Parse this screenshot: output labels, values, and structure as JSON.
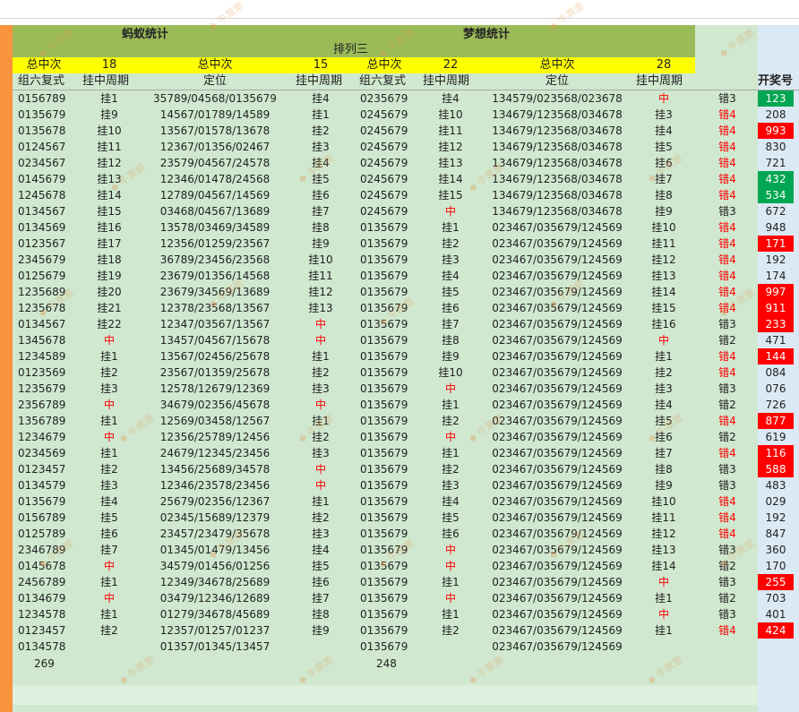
{
  "titles": {
    "left": "蚂蚁统计",
    "right": "梦想统计",
    "sub": "排列三"
  },
  "summary": {
    "label": "总中次",
    "a_hits": "18",
    "b_hits": "15",
    "c_hits": "22",
    "d_hits": "28"
  },
  "columns": {
    "combo": "组六复式",
    "cycle": "挂中周期",
    "pos": "定位",
    "result": "开奖号"
  },
  "rows": [
    {
      "a": "0156789",
      "b": "挂1",
      "c": "35789/04568/0135679",
      "d": "挂4",
      "e": "0235679",
      "f": "挂4",
      "g": "134579/023568/023678",
      "h": "中",
      "i": "错3",
      "r": "123",
      "rc": "g"
    },
    {
      "a": "0135679",
      "b": "挂9",
      "c": "14567/01789/14589",
      "d": "挂1",
      "e": "0245679",
      "f": "挂10",
      "g": "134679/123568/034678",
      "h": "挂3",
      "i": "错4",
      "r": "208",
      "rc": ""
    },
    {
      "a": "0135678",
      "b": "挂10",
      "c": "13567/01578/13678",
      "d": "挂2",
      "e": "0245679",
      "f": "挂11",
      "g": "134679/123568/034678",
      "h": "挂4",
      "i": "错4",
      "r": "993",
      "rc": "r"
    },
    {
      "a": "0124567",
      "b": "挂11",
      "c": "12367/01356/02467",
      "d": "挂3",
      "e": "0245679",
      "f": "挂12",
      "g": "134679/123568/034678",
      "h": "挂5",
      "i": "错4",
      "r": "830",
      "rc": ""
    },
    {
      "a": "0234567",
      "b": "挂12",
      "c": "23579/04567/24578",
      "d": "挂4",
      "e": "0245679",
      "f": "挂13",
      "g": "134679/123568/034678",
      "h": "挂6",
      "i": "错4",
      "r": "721",
      "rc": ""
    },
    {
      "a": "0145679",
      "b": "挂13",
      "c": "12346/01478/24568",
      "d": "挂5",
      "e": "0245679",
      "f": "挂14",
      "g": "134679/123568/034678",
      "h": "挂7",
      "i": "错4",
      "r": "432",
      "rc": "g"
    },
    {
      "a": "1245678",
      "b": "挂14",
      "c": "12789/04567/14569",
      "d": "挂6",
      "e": "0245679",
      "f": "挂15",
      "g": "134679/123568/034678",
      "h": "挂8",
      "i": "错4",
      "r": "534",
      "rc": "g"
    },
    {
      "a": "0134567",
      "b": "挂15",
      "c": "03468/04567/13689",
      "d": "挂7",
      "e": "0245679",
      "f": "中",
      "g": "134679/123568/034678",
      "h": "挂9",
      "i": "错3",
      "r": "672",
      "rc": ""
    },
    {
      "a": "0134569",
      "b": "挂16",
      "c": "13578/03469/34589",
      "d": "挂8",
      "e": "0135679",
      "f": "挂1",
      "g": "023467/035679/124569",
      "h": "挂10",
      "i": "错4",
      "r": "948",
      "rc": ""
    },
    {
      "a": "0123567",
      "b": "挂17",
      "c": "12356/01259/23567",
      "d": "挂9",
      "e": "0135679",
      "f": "挂2",
      "g": "023467/035679/124569",
      "h": "挂11",
      "i": "错4",
      "r": "171",
      "rc": "r"
    },
    {
      "a": "2345679",
      "b": "挂18",
      "c": "36789/23456/23568",
      "d": "挂10",
      "e": "0135679",
      "f": "挂3",
      "g": "023467/035679/124569",
      "h": "挂12",
      "i": "错4",
      "r": "192",
      "rc": ""
    },
    {
      "a": "0125679",
      "b": "挂19",
      "c": "23679/01356/14568",
      "d": "挂11",
      "e": "0135679",
      "f": "挂4",
      "g": "023467/035679/124569",
      "h": "挂13",
      "i": "错4",
      "r": "174",
      "rc": ""
    },
    {
      "a": "1235689",
      "b": "挂20",
      "c": "23679/34569/13689",
      "d": "挂12",
      "e": "0135679",
      "f": "挂5",
      "g": "023467/035679/124569",
      "h": "挂14",
      "i": "错4",
      "r": "997",
      "rc": "r"
    },
    {
      "a": "1235678",
      "b": "挂21",
      "c": "12378/23568/13567",
      "d": "挂13",
      "e": "0135679",
      "f": "挂6",
      "g": "023467/035679/124569",
      "h": "挂15",
      "i": "错4",
      "r": "911",
      "rc": "r"
    },
    {
      "a": "0134567",
      "b": "挂22",
      "c": "12347/03567/13567",
      "d": "中",
      "e": "0135679",
      "f": "挂7",
      "g": "023467/035679/124569",
      "h": "挂16",
      "i": "错3",
      "r": "233",
      "rc": "r"
    },
    {
      "a": "1345678",
      "b": "中",
      "c": "13457/04567/15678",
      "d": "中",
      "e": "0135679",
      "f": "挂8",
      "g": "023467/035679/124569",
      "h": "中",
      "i": "错2",
      "r": "471",
      "rc": ""
    },
    {
      "a": "1234589",
      "b": "挂1",
      "c": "13567/02456/25678",
      "d": "挂1",
      "e": "0135679",
      "f": "挂9",
      "g": "023467/035679/124569",
      "h": "挂1",
      "i": "错4",
      "r": "144",
      "rc": "r"
    },
    {
      "a": "0123569",
      "b": "挂2",
      "c": "23567/01359/25678",
      "d": "挂2",
      "e": "0135679",
      "f": "挂10",
      "g": "023467/035679/124569",
      "h": "挂2",
      "i": "错4",
      "r": "084",
      "rc": ""
    },
    {
      "a": "1235679",
      "b": "挂3",
      "c": "12578/12679/12369",
      "d": "挂3",
      "e": "0135679",
      "f": "中",
      "g": "023467/035679/124569",
      "h": "挂3",
      "i": "错3",
      "r": "076",
      "rc": ""
    },
    {
      "a": "2356789",
      "b": "中",
      "c": "34679/02356/45678",
      "d": "中",
      "e": "0135679",
      "f": "挂1",
      "g": "023467/035679/124569",
      "h": "挂4",
      "i": "错2",
      "r": "726",
      "rc": ""
    },
    {
      "a": "1356789",
      "b": "挂1",
      "c": "12569/03458/12567",
      "d": "挂1",
      "e": "0135679",
      "f": "挂2",
      "g": "023467/035679/124569",
      "h": "挂5",
      "i": "错4",
      "r": "877",
      "rc": "r"
    },
    {
      "a": "1234679",
      "b": "中",
      "c": "12356/25789/12456",
      "d": "挂2",
      "e": "0135679",
      "f": "中",
      "g": "023467/035679/124569",
      "h": "挂6",
      "i": "错2",
      "r": "619",
      "rc": ""
    },
    {
      "a": "0234569",
      "b": "挂1",
      "c": "24679/12345/23456",
      "d": "挂3",
      "e": "0135679",
      "f": "挂1",
      "g": "023467/035679/124569",
      "h": "挂7",
      "i": "错4",
      "r": "116",
      "rc": "r"
    },
    {
      "a": "0123457",
      "b": "挂2",
      "c": "13456/25689/34578",
      "d": "中",
      "e": "0135679",
      "f": "挂2",
      "g": "023467/035679/124569",
      "h": "挂8",
      "i": "错3",
      "r": "588",
      "rc": "r"
    },
    {
      "a": "0134579",
      "b": "挂3",
      "c": "12346/23578/23456",
      "d": "中",
      "e": "0135679",
      "f": "挂3",
      "g": "023467/035679/124569",
      "h": "挂9",
      "i": "错3",
      "r": "483",
      "rc": ""
    },
    {
      "a": "0135679",
      "b": "挂4",
      "c": "25679/02356/12367",
      "d": "挂1",
      "e": "0135679",
      "f": "挂4",
      "g": "023467/035679/124569",
      "h": "挂10",
      "i": "错4",
      "r": "029",
      "rc": ""
    },
    {
      "a": "0156789",
      "b": "挂5",
      "c": "02345/15689/12379",
      "d": "挂2",
      "e": "0135679",
      "f": "挂5",
      "g": "023467/035679/124569",
      "h": "挂11",
      "i": "错4",
      "r": "192",
      "rc": ""
    },
    {
      "a": "0125789",
      "b": "挂6",
      "c": "23457/23479/35678",
      "d": "挂3",
      "e": "0135679",
      "f": "挂6",
      "g": "023467/035679/124569",
      "h": "挂12",
      "i": "错4",
      "r": "847",
      "rc": ""
    },
    {
      "a": "2346789",
      "b": "挂7",
      "c": "01345/01479/13456",
      "d": "挂4",
      "e": "0135679",
      "f": "中",
      "g": "023467/035679/124569",
      "h": "挂13",
      "i": "错3",
      "r": "360",
      "rc": ""
    },
    {
      "a": "0145678",
      "b": "中",
      "c": "34579/01456/01256",
      "d": "挂5",
      "e": "0135679",
      "f": "中",
      "g": "023467/035679/124569",
      "h": "挂14",
      "i": "错2",
      "r": "170",
      "rc": ""
    },
    {
      "a": "2456789",
      "b": "挂1",
      "c": "12349/34678/25689",
      "d": "挂6",
      "e": "0135679",
      "f": "挂1",
      "g": "023467/035679/124569",
      "h": "中",
      "i": "错3",
      "r": "255",
      "rc": "r"
    },
    {
      "a": "0134679",
      "b": "中",
      "c": "03479/12346/12689",
      "d": "挂7",
      "e": "0135679",
      "f": "中",
      "g": "023467/035679/124569",
      "h": "挂1",
      "i": "错2",
      "r": "703",
      "rc": ""
    },
    {
      "a": "1234578",
      "b": "挂1",
      "c": "01279/34678/45689",
      "d": "挂8",
      "e": "0135679",
      "f": "挂1",
      "g": "023467/035679/124569",
      "h": "中",
      "i": "错3",
      "r": "401",
      "rc": ""
    },
    {
      "a": "0123457",
      "b": "挂2",
      "c": "12357/01257/01237",
      "d": "挂9",
      "e": "0135679",
      "f": "挂2",
      "g": "023467/035679/124569",
      "h": "挂1",
      "i": "错4",
      "r": "424",
      "rc": "r"
    },
    {
      "a": "0134578",
      "b": "",
      "c": "01357/01345/13457",
      "d": "",
      "e": "0135679",
      "f": "",
      "g": "023467/035679/124569",
      "h": "",
      "i": "",
      "r": "",
      "rc": ""
    }
  ],
  "footer": {
    "left_total": "269",
    "right_total": "248"
  },
  "watermark": "牛票票"
}
